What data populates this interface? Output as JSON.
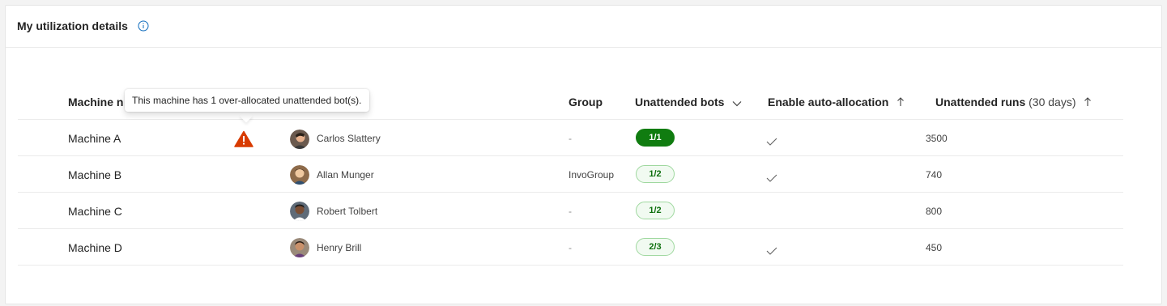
{
  "card": {
    "title": "My utilization details",
    "info_icon": "info-icon"
  },
  "tooltip": {
    "text": "This machine has 1 over-allocated unattended bot(s)."
  },
  "columns": {
    "machine": "Machine n",
    "group": "Group",
    "unattended_bots": "Unattended bots",
    "auto_allocation": "Enable auto-allocation",
    "runs": "Unattended runs",
    "runs_sub": "(30 days)"
  },
  "rows": [
    {
      "machine": "Machine A",
      "user": "Carlos Slattery",
      "group": "-",
      "bots": "1/1",
      "auto_allocation": true,
      "runs": "3500",
      "warning": true
    },
    {
      "machine": "Machine B",
      "user": "Allan Munger",
      "group": "InvoGroup",
      "bots": "1/2",
      "auto_allocation": true,
      "runs": "740",
      "warning": false
    },
    {
      "machine": "Machine C",
      "user": "Robert Tolbert",
      "group": "-",
      "bots": "1/2",
      "auto_allocation": false,
      "runs": "800",
      "warning": false
    },
    {
      "machine": "Machine D",
      "user": "Henry Brill",
      "group": "-",
      "bots": "2/3",
      "auto_allocation": true,
      "runs": "450",
      "warning": false
    }
  ],
  "colors": {
    "accent": "#0f6cbd",
    "success": "#107c10",
    "warning": "#d83b01"
  }
}
